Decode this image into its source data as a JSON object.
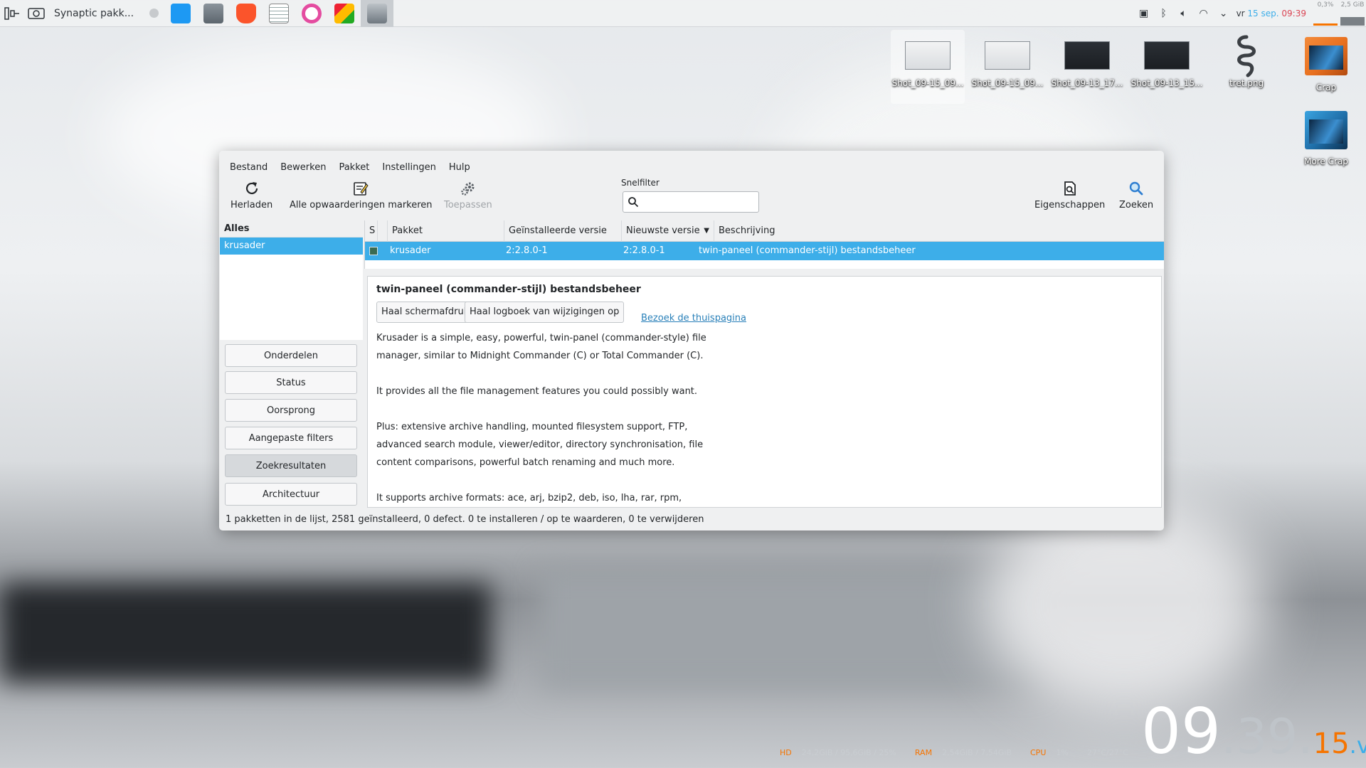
{
  "taskbar": {
    "task_title": "Synaptic pakk...",
    "clock_day": "vr ",
    "clock_date": "15 sep.",
    "clock_time": "09:39",
    "meter1_value": "0,3%",
    "meter2_value": "2,5 GiB"
  },
  "desktop_icons": [
    {
      "label": "Shot_09-15_09...",
      "type": "thumb-light"
    },
    {
      "label": "Shot_09-15_09...",
      "type": "thumb-light"
    },
    {
      "label": "Shot_09-13_17...",
      "type": "thumb-dark"
    },
    {
      "label": "Shot_09-13_15...",
      "type": "thumb-dark"
    },
    {
      "label": "tret.png",
      "type": "snake-icon"
    },
    {
      "label": "Crap",
      "type": "folder-orange"
    },
    {
      "label": "More Crap",
      "type": "folder-blue"
    }
  ],
  "menu": [
    "Bestand",
    "Bewerken",
    "Pakket",
    "Instellingen",
    "Hulp"
  ],
  "toolbar": {
    "reload": "Herladen",
    "mark_all": "Alle opwaarderingen markeren",
    "apply": "Toepassen",
    "properties": "Eigenschappen",
    "search": "Zoeken",
    "quickfilter_label": "Snelfilter",
    "quickfilter_value": ""
  },
  "filters": {
    "header": "Alles",
    "items": [
      "krusader"
    ],
    "selected": 0
  },
  "category_buttons": [
    "Onderdelen",
    "Status",
    "Oorsprong",
    "Aangepaste filters",
    "Zoekresultaten",
    "Architectuur"
  ],
  "pressed_category": "Zoekresultaten",
  "table": {
    "columns": [
      "S",
      "Pakket",
      "Geïnstalleerde versie",
      "Nieuwste versie",
      "Beschrijving"
    ],
    "rows": [
      {
        "package": "krusader",
        "installed": "2:2.8.0-1",
        "latest": "2:2.8.0-1",
        "description": "twin-paneel (commander-stijl) bestandsbeheer"
      }
    ]
  },
  "details": {
    "title": "twin-paneel (commander-stijl) bestandsbeheer",
    "screenshot_button": "Haal schermafdruk op",
    "changelog_button": "Haal logboek van wijzigingen op",
    "homepage_link": "Bezoek de thuispagina",
    "lines": [
      "Krusader is a simple, easy, powerful, twin-panel (commander-style) file",
      "manager, similar to Midnight Commander (C) or Total Commander (C).",
      "",
      "It provides all the file management features you could possibly want.",
      "",
      "Plus: extensive archive handling, mounted filesystem support, FTP,",
      "advanced search module, viewer/editor, directory synchronisation, file",
      "content comparisons, powerful batch renaming and much more.",
      "",
      "It supports archive formats: ace, arj, bzip2, deb, iso, lha, rar, rpm,"
    ]
  },
  "statusbar": "1 pakketten in de lijst, 2581 geïnstalleerd, 0 defect. 0 te installeren / op te waarderen, 0 te verwijderen",
  "sysmon": {
    "hd_label": "HD",
    "hd_value": "24,2GiB / 95,6GiB / 25%",
    "ram_label": "RAM",
    "ram_value": "2,54GiB / 7,54GiB",
    "cpu_label": "CPU",
    "cpu_value": "1%",
    "temp_value": "27°C/27°C"
  },
  "big_clock": {
    "hours": "09",
    "minutes": "39",
    "seconds": "15",
    "day": "vr"
  },
  "colors": {
    "accent": "#3daee9",
    "orange": "#f67400",
    "selection": "#3daee9",
    "time_red": "#da4453"
  }
}
